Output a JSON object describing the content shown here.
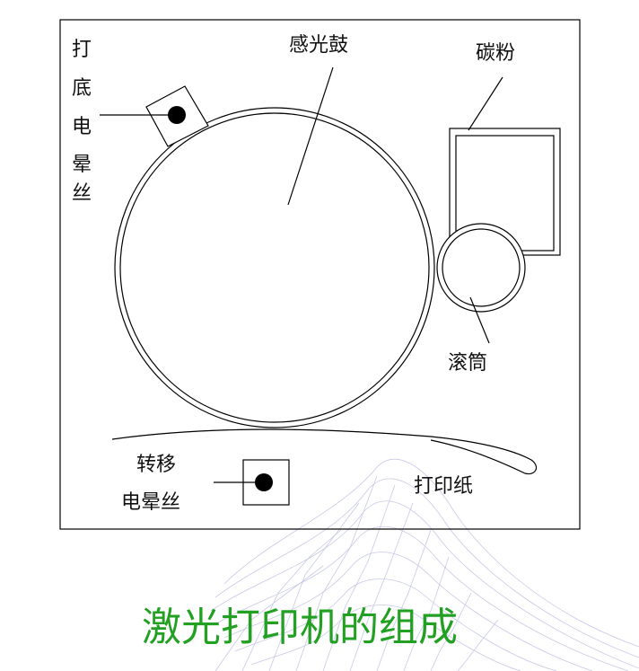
{
  "labels": {
    "drum": "感光鼓",
    "toner": "碳粉",
    "roller": "滚筒",
    "charge_wire_chars": [
      "打",
      "底",
      "电",
      "晕",
      "丝"
    ],
    "transfer_line1": "转移",
    "transfer_line2": "电晕丝",
    "paper": "打印纸"
  },
  "title": "激光打印机的组成",
  "colors": {
    "title": "#22a022",
    "line": "#000000",
    "mesh": "#c7c9e6"
  }
}
